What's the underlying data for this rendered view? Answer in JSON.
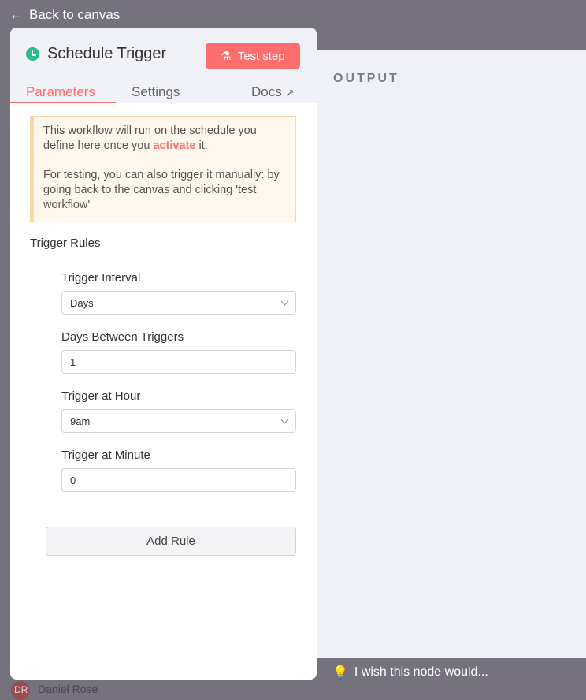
{
  "nav": {
    "back_label": "Back to canvas"
  },
  "background": {
    "user_name": "Daniel Rose",
    "user_initials": "DR"
  },
  "node": {
    "title": "Schedule Trigger",
    "test_label": "Test step",
    "icon": "clock-icon"
  },
  "tabs": [
    {
      "label": "Parameters",
      "active": true
    },
    {
      "label": "Settings"
    },
    {
      "label": "Docs"
    }
  ],
  "notice": {
    "line1_pre": "This workflow will run on the schedule you define here once you ",
    "activate": "activate",
    "line1_post": " it.",
    "line2": "For testing, you can also trigger it manually: by going back to the canvas and clicking 'test workflow'"
  },
  "section_title": "Trigger Rules",
  "fields": [
    {
      "label": "Trigger Interval",
      "value": "Days",
      "type": "select"
    },
    {
      "label": "Days Between Triggers",
      "value": "1",
      "type": "input"
    },
    {
      "label": "Trigger at Hour",
      "value": "9am",
      "type": "select"
    },
    {
      "label": "Trigger at Minute",
      "value": "0",
      "type": "input"
    }
  ],
  "add_rule_label": "Add Rule",
  "output": {
    "title": "OUTPUT"
  },
  "feedback": {
    "label": "I wish this node would..."
  },
  "colors": {
    "accent": "#ff6d6d",
    "trigger_green": "#2db98e",
    "notice_bg": "#fef7ec"
  }
}
